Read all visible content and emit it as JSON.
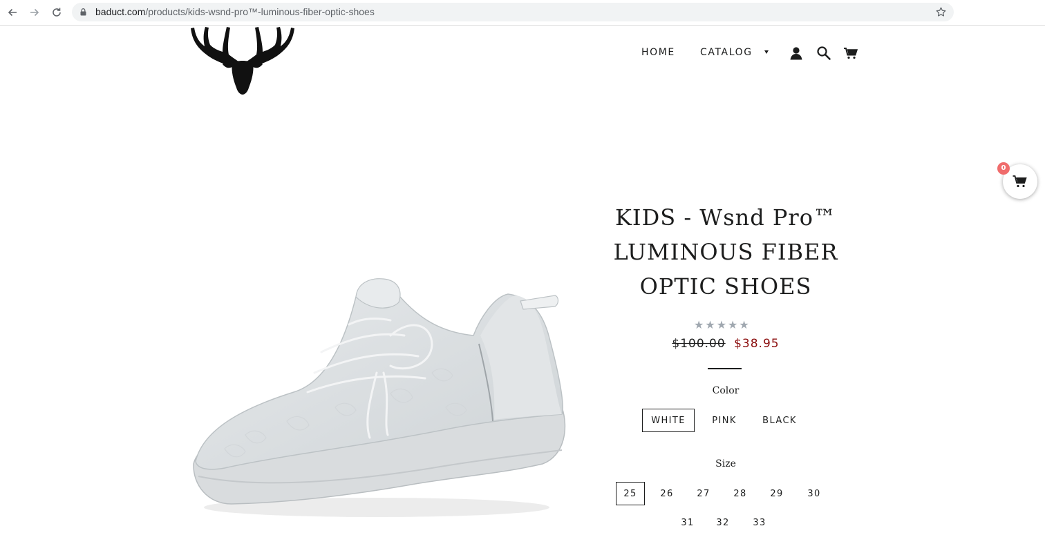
{
  "browser": {
    "url_host": "baduct.com",
    "url_path": "/products/kids-wsnd-pro™-luminous-fiber-optic-shoes"
  },
  "nav": {
    "home": "HOME",
    "catalog": "CATALOG"
  },
  "floating_cart": {
    "count": "0"
  },
  "product": {
    "title_line1": "KIDS - Wsnd Pro™",
    "title_line2": "LUMINOUS FIBER",
    "title_line3": "OPTIC SHOES",
    "rating_stars": "★★★★★",
    "rating_value": 0,
    "price_compare": "$100.00",
    "price_sale": "$38.95",
    "color_label": "Color",
    "colors": [
      "WHITE",
      "PINK",
      "BLACK"
    ],
    "selected_color": "WHITE",
    "size_label": "Size",
    "sizes": [
      "25",
      "26",
      "27",
      "28",
      "29",
      "30",
      "31",
      "32",
      "33"
    ],
    "selected_size": "25"
  },
  "colors": {
    "text": "#1c1d1d",
    "sale_price": "#8b0d0d",
    "badge": "#f06c6c",
    "stars": "#a0a8b0"
  }
}
